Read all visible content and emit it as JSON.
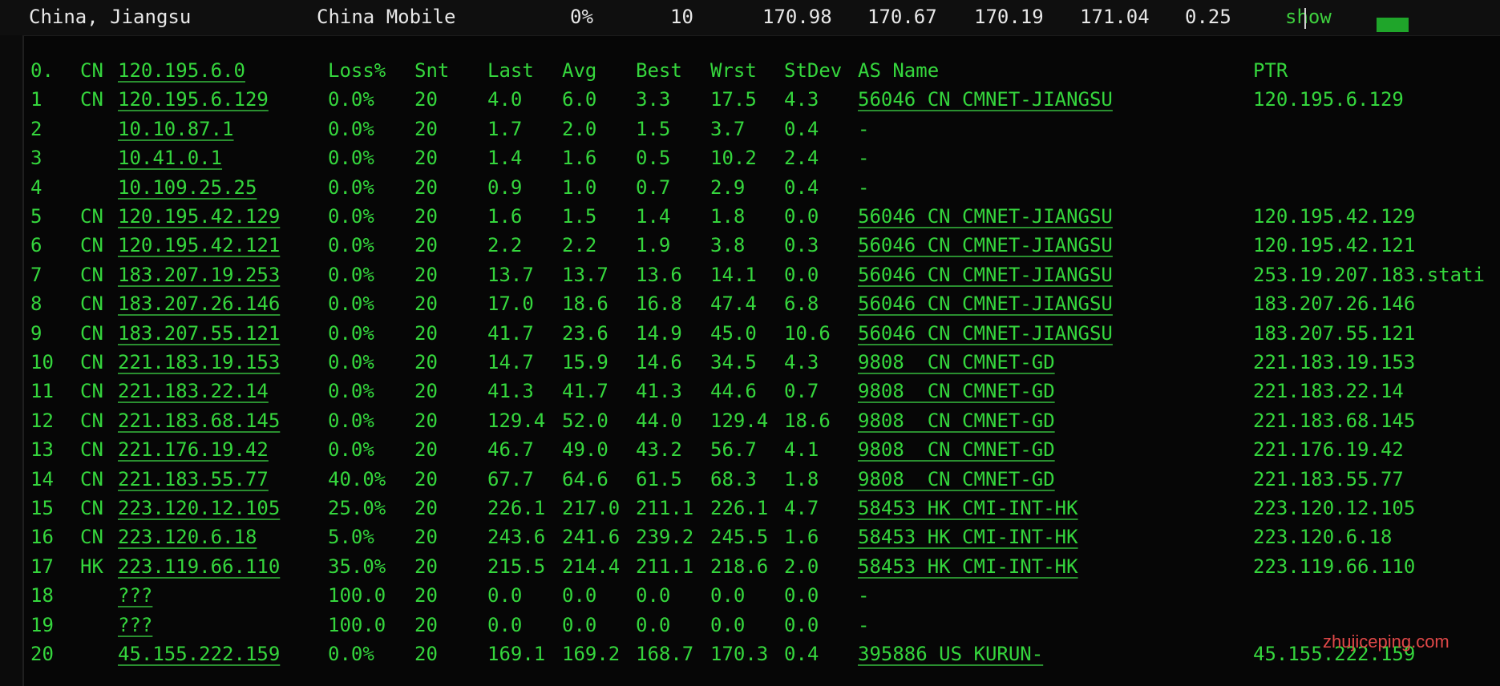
{
  "summary": {
    "location": "China, Jiangsu",
    "isp": "China Mobile",
    "loss": "0%",
    "sent": "10",
    "last": "170.98",
    "avg": "170.67",
    "best": "170.19",
    "worst": "171.04",
    "stdev": "0.25",
    "show_label": "show"
  },
  "headers": {
    "hop": "0.",
    "cc": "CN",
    "host": "120.195.6.0",
    "loss": "Loss%",
    "snt": "Snt",
    "last": "Last",
    "avg": "Avg",
    "best": "Best",
    "wrst": "Wrst",
    "stdev": "StDev",
    "asname": "AS Name",
    "ptr": "PTR"
  },
  "hops": [
    {
      "hop": "1",
      "cc": "CN",
      "host": "120.195.6.129",
      "loss": "0.0%",
      "snt": "20",
      "last": "4.0",
      "avg": "6.0",
      "best": "3.3",
      "wrst": "17.5",
      "stdev": "4.3",
      "asname": "56046 CN CMNET-JIANGSU",
      "ptr": "120.195.6.129"
    },
    {
      "hop": "2",
      "cc": "",
      "host": "10.10.87.1",
      "loss": "0.0%",
      "snt": "20",
      "last": "1.7",
      "avg": "2.0",
      "best": "1.5",
      "wrst": "3.7",
      "stdev": "0.4",
      "asname": "-",
      "ptr": ""
    },
    {
      "hop": "3",
      "cc": "",
      "host": "10.41.0.1",
      "loss": "0.0%",
      "snt": "20",
      "last": "1.4",
      "avg": "1.6",
      "best": "0.5",
      "wrst": "10.2",
      "stdev": "2.4",
      "asname": "-",
      "ptr": ""
    },
    {
      "hop": "4",
      "cc": "",
      "host": "10.109.25.25",
      "loss": "0.0%",
      "snt": "20",
      "last": "0.9",
      "avg": "1.0",
      "best": "0.7",
      "wrst": "2.9",
      "stdev": "0.4",
      "asname": "-",
      "ptr": ""
    },
    {
      "hop": "5",
      "cc": "CN",
      "host": "120.195.42.129",
      "loss": "0.0%",
      "snt": "20",
      "last": "1.6",
      "avg": "1.5",
      "best": "1.4",
      "wrst": "1.8",
      "stdev": "0.0",
      "asname": "56046 CN CMNET-JIANGSU",
      "ptr": "120.195.42.129"
    },
    {
      "hop": "6",
      "cc": "CN",
      "host": "120.195.42.121",
      "loss": "0.0%",
      "snt": "20",
      "last": "2.2",
      "avg": "2.2",
      "best": "1.9",
      "wrst": "3.8",
      "stdev": "0.3",
      "asname": "56046 CN CMNET-JIANGSU",
      "ptr": "120.195.42.121"
    },
    {
      "hop": "7",
      "cc": "CN",
      "host": "183.207.19.253",
      "loss": "0.0%",
      "snt": "20",
      "last": "13.7",
      "avg": "13.7",
      "best": "13.6",
      "wrst": "14.1",
      "stdev": "0.0",
      "asname": "56046 CN CMNET-JIANGSU",
      "ptr": "253.19.207.183.stati"
    },
    {
      "hop": "8",
      "cc": "CN",
      "host": "183.207.26.146",
      "loss": "0.0%",
      "snt": "20",
      "last": "17.0",
      "avg": "18.6",
      "best": "16.8",
      "wrst": "47.4",
      "stdev": "6.8",
      "asname": "56046 CN CMNET-JIANGSU",
      "ptr": "183.207.26.146"
    },
    {
      "hop": "9",
      "cc": "CN",
      "host": "183.207.55.121",
      "loss": "0.0%",
      "snt": "20",
      "last": "41.7",
      "avg": "23.6",
      "best": "14.9",
      "wrst": "45.0",
      "stdev": "10.6",
      "asname": "56046 CN CMNET-JIANGSU",
      "ptr": "183.207.55.121"
    },
    {
      "hop": "10",
      "cc": "CN",
      "host": "221.183.19.153",
      "loss": "0.0%",
      "snt": "20",
      "last": "14.7",
      "avg": "15.9",
      "best": "14.6",
      "wrst": "34.5",
      "stdev": "4.3",
      "asname": "9808  CN CMNET-GD",
      "ptr": "221.183.19.153"
    },
    {
      "hop": "11",
      "cc": "CN",
      "host": "221.183.22.14",
      "loss": "0.0%",
      "snt": "20",
      "last": "41.3",
      "avg": "41.7",
      "best": "41.3",
      "wrst": "44.6",
      "stdev": "0.7",
      "asname": "9808  CN CMNET-GD",
      "ptr": "221.183.22.14"
    },
    {
      "hop": "12",
      "cc": "CN",
      "host": "221.183.68.145",
      "loss": "0.0%",
      "snt": "20",
      "last": "129.4",
      "avg": "52.0",
      "best": "44.0",
      "wrst": "129.4",
      "stdev": "18.6",
      "asname": "9808  CN CMNET-GD",
      "ptr": "221.183.68.145"
    },
    {
      "hop": "13",
      "cc": "CN",
      "host": "221.176.19.42",
      "loss": "0.0%",
      "snt": "20",
      "last": "46.7",
      "avg": "49.0",
      "best": "43.2",
      "wrst": "56.7",
      "stdev": "4.1",
      "asname": "9808  CN CMNET-GD",
      "ptr": "221.176.19.42"
    },
    {
      "hop": "14",
      "cc": "CN",
      "host": "221.183.55.77",
      "loss": "40.0%",
      "snt": "20",
      "last": "67.7",
      "avg": "64.6",
      "best": "61.5",
      "wrst": "68.3",
      "stdev": "1.8",
      "asname": "9808  CN CMNET-GD",
      "ptr": "221.183.55.77"
    },
    {
      "hop": "15",
      "cc": "CN",
      "host": "223.120.12.105",
      "loss": "25.0%",
      "snt": "20",
      "last": "226.1",
      "avg": "217.0",
      "best": "211.1",
      "wrst": "226.1",
      "stdev": "4.7",
      "asname": "58453 HK CMI-INT-HK",
      "ptr": "223.120.12.105"
    },
    {
      "hop": "16",
      "cc": "CN",
      "host": "223.120.6.18",
      "loss": "5.0%",
      "snt": "20",
      "last": "243.6",
      "avg": "241.6",
      "best": "239.2",
      "wrst": "245.5",
      "stdev": "1.6",
      "asname": "58453 HK CMI-INT-HK",
      "ptr": "223.120.6.18"
    },
    {
      "hop": "17",
      "cc": "HK",
      "host": "223.119.66.110",
      "loss": "35.0%",
      "snt": "20",
      "last": "215.5",
      "avg": "214.4",
      "best": "211.1",
      "wrst": "218.6",
      "stdev": "2.0",
      "asname": "58453 HK CMI-INT-HK",
      "ptr": "223.119.66.110"
    },
    {
      "hop": "18",
      "cc": "",
      "host": "???",
      "loss": "100.0",
      "snt": "20",
      "last": "0.0",
      "avg": "0.0",
      "best": "0.0",
      "wrst": "0.0",
      "stdev": "0.0",
      "asname": "-",
      "ptr": ""
    },
    {
      "hop": "19",
      "cc": "",
      "host": "???",
      "loss": "100.0",
      "snt": "20",
      "last": "0.0",
      "avg": "0.0",
      "best": "0.0",
      "wrst": "0.0",
      "stdev": "0.0",
      "asname": "-",
      "ptr": ""
    },
    {
      "hop": "20",
      "cc": "",
      "host": "45.155.222.159",
      "loss": "0.0%",
      "snt": "20",
      "last": "169.1",
      "avg": "169.2",
      "best": "168.7",
      "wrst": "170.3",
      "stdev": "0.4",
      "asname": "395886 US KURUN-",
      "ptr": "45.155.222.159"
    }
  ],
  "watermark": "zhujiceping.com",
  "colors": {
    "terminal_text": "#35d63d",
    "summary_text": "#e8e8e8",
    "watermark": "#e04848",
    "indicator": "#1fa52a"
  }
}
